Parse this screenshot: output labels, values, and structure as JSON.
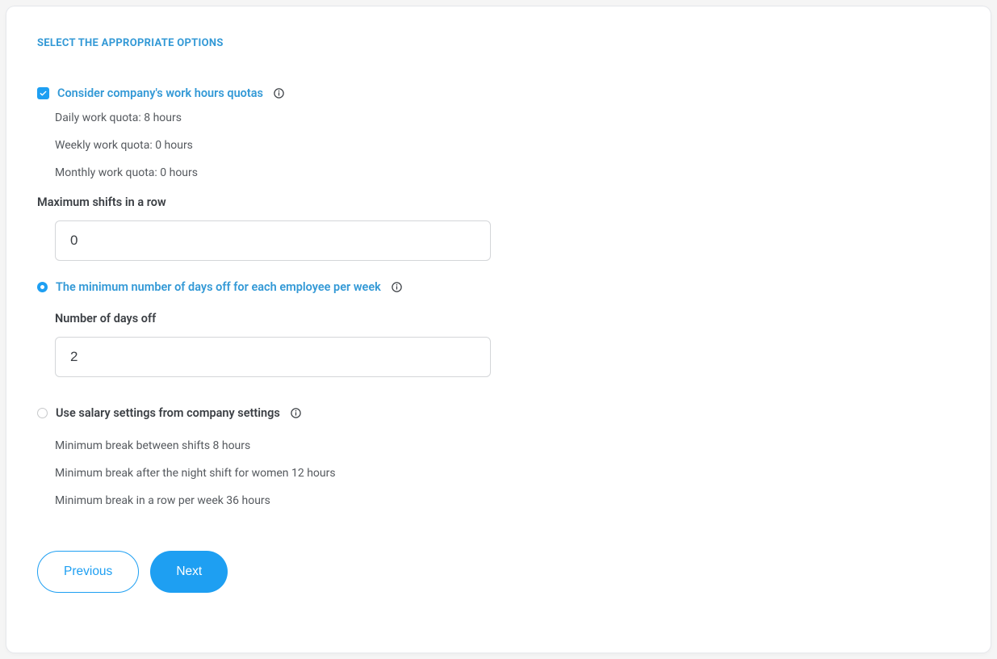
{
  "section_title": "SELECT THE APPROPRIATE OPTIONS",
  "option1": {
    "checked": true,
    "label": "Consider company's work hours quotas",
    "quotas": {
      "daily": "Daily work quota: 8 hours",
      "weekly": "Weekly work quota: 0 hours",
      "monthly": "Monthly work quota: 0 hours"
    }
  },
  "max_shifts": {
    "label": "Maximum shifts in a row",
    "value": "0"
  },
  "option2": {
    "selected": true,
    "label": "The minimum number of days off for each employee per week",
    "days_off_label": "Number of days off",
    "days_off_value": "2"
  },
  "option3": {
    "selected": false,
    "label": "Use salary settings from company settings",
    "breaks": {
      "between": "Minimum break between shifts 8 hours",
      "night_women": "Minimum break after the night shift for women 12 hours",
      "row_week": "Minimum break in a row per week 36 hours"
    }
  },
  "buttons": {
    "previous": "Previous",
    "next": "Next"
  }
}
